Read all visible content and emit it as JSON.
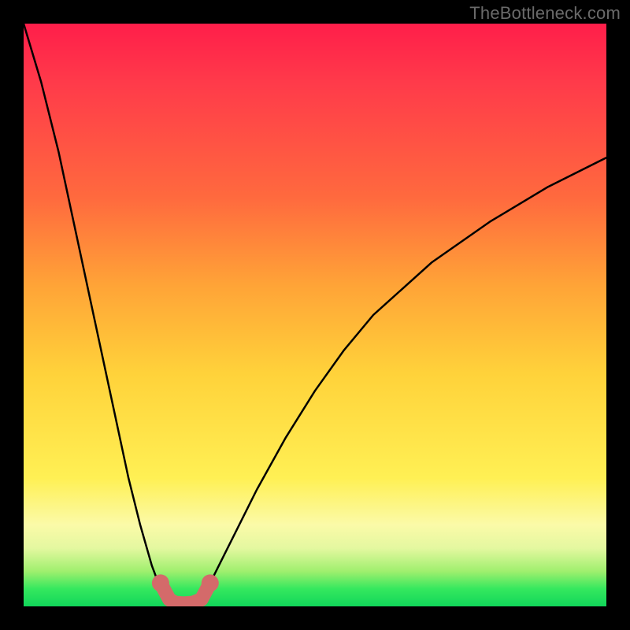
{
  "watermark": {
    "text": "TheBottleneck.com"
  },
  "colors": {
    "background": "#000000",
    "curve": "#000000",
    "marker_fill": "#d46a6a",
    "marker_stroke": "#c65b5b"
  },
  "chart_data": {
    "type": "line",
    "title": "",
    "xlabel": "",
    "ylabel": "",
    "xlim": [
      0,
      100
    ],
    "ylim": [
      0,
      100
    ],
    "notes": "Heat-map background: red (top / high bottleneck) to green (bottom / optimal). Black curve shows bottleneck %, dipping to ~0 near x≈27 where a salmon marker band highlights the optimal zone.",
    "series": [
      {
        "name": "bottleneck-curve-left",
        "x": [
          0,
          3,
          6,
          9,
          12,
          15,
          18,
          20,
          22,
          23.5,
          25
        ],
        "y": [
          100,
          90,
          78,
          64,
          50,
          36,
          22,
          14,
          7,
          3,
          0.5
        ]
      },
      {
        "name": "bottleneck-curve-right",
        "x": [
          30,
          32,
          34,
          37,
          40,
          45,
          50,
          55,
          60,
          70,
          80,
          90,
          100
        ],
        "y": [
          0.5,
          4,
          8,
          14,
          20,
          29,
          37,
          44,
          50,
          59,
          66,
          72,
          77
        ]
      },
      {
        "name": "optimal-marker-band",
        "x": [
          23.5,
          25,
          26,
          27.5,
          29,
          30.5,
          32
        ],
        "y": [
          4,
          1.2,
          0.6,
          0.5,
          0.6,
          1.2,
          4
        ]
      }
    ]
  }
}
